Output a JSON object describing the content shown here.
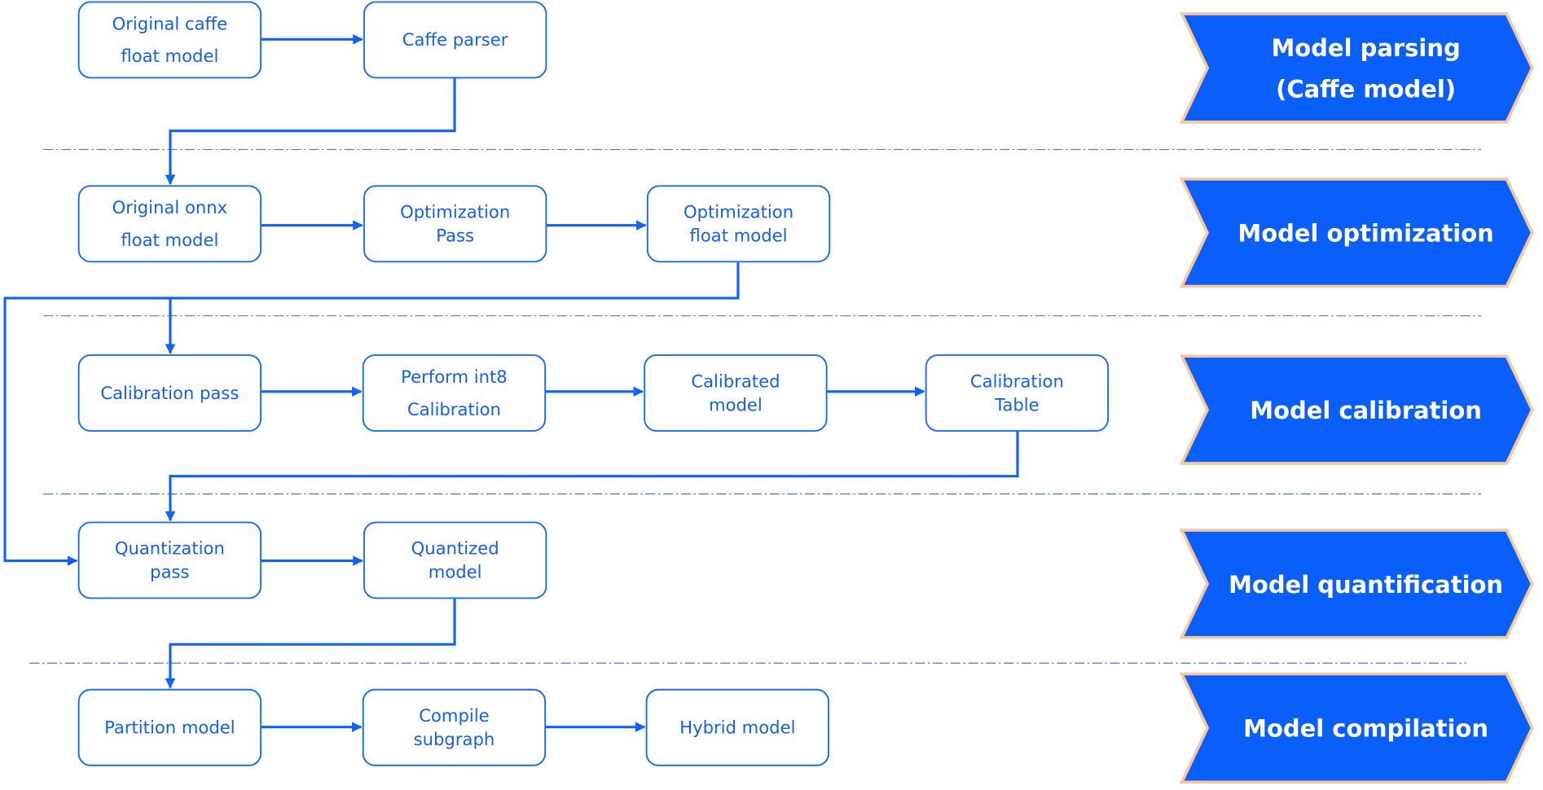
{
  "colors": {
    "accent": "#0a5ffa",
    "box_border": "#1a6cf5",
    "box_text": "#1260f0",
    "chevron_glow": "#f9c79c",
    "hybrid_text": "#1a7fb8"
  },
  "boxes": [
    {
      "id": "original-caffe",
      "lines": [
        "Original caffe",
        "float model"
      ]
    },
    {
      "id": "caffe-parser",
      "lines": [
        "Caffe parser"
      ]
    },
    {
      "id": "original-onnx",
      "lines": [
        "Original onnx",
        "float model"
      ]
    },
    {
      "id": "optimization-pass",
      "lines": [
        "Optimization",
        "Pass"
      ]
    },
    {
      "id": "optimization-float",
      "lines": [
        "Optimization",
        "float model"
      ]
    },
    {
      "id": "calibration-pass",
      "lines": [
        "Calibration pass"
      ]
    },
    {
      "id": "perform-int8",
      "lines": [
        "Perform int8",
        "Calibration"
      ]
    },
    {
      "id": "calibrated-model",
      "lines": [
        "Calibrated",
        "model"
      ]
    },
    {
      "id": "calibration-table",
      "lines": [
        "Calibration",
        "Table"
      ]
    },
    {
      "id": "quantization-pass",
      "lines": [
        "Quantization",
        "pass"
      ]
    },
    {
      "id": "quantized-model",
      "lines": [
        "Quantized",
        "model"
      ]
    },
    {
      "id": "partition-model",
      "lines": [
        "Partition model"
      ]
    },
    {
      "id": "compile-subgraph",
      "lines": [
        "Compile",
        "subgraph"
      ]
    },
    {
      "id": "hybrid-model",
      "lines": [
        "Hybrid model"
      ]
    }
  ],
  "stages": [
    {
      "lines": [
        "Model parsing",
        "(Caffe model)"
      ]
    },
    {
      "lines": [
        "Model optimization"
      ]
    },
    {
      "lines": [
        "Model calibration"
      ]
    },
    {
      "lines": [
        "Model quantification"
      ]
    },
    {
      "lines": [
        "Model compilation"
      ]
    }
  ]
}
